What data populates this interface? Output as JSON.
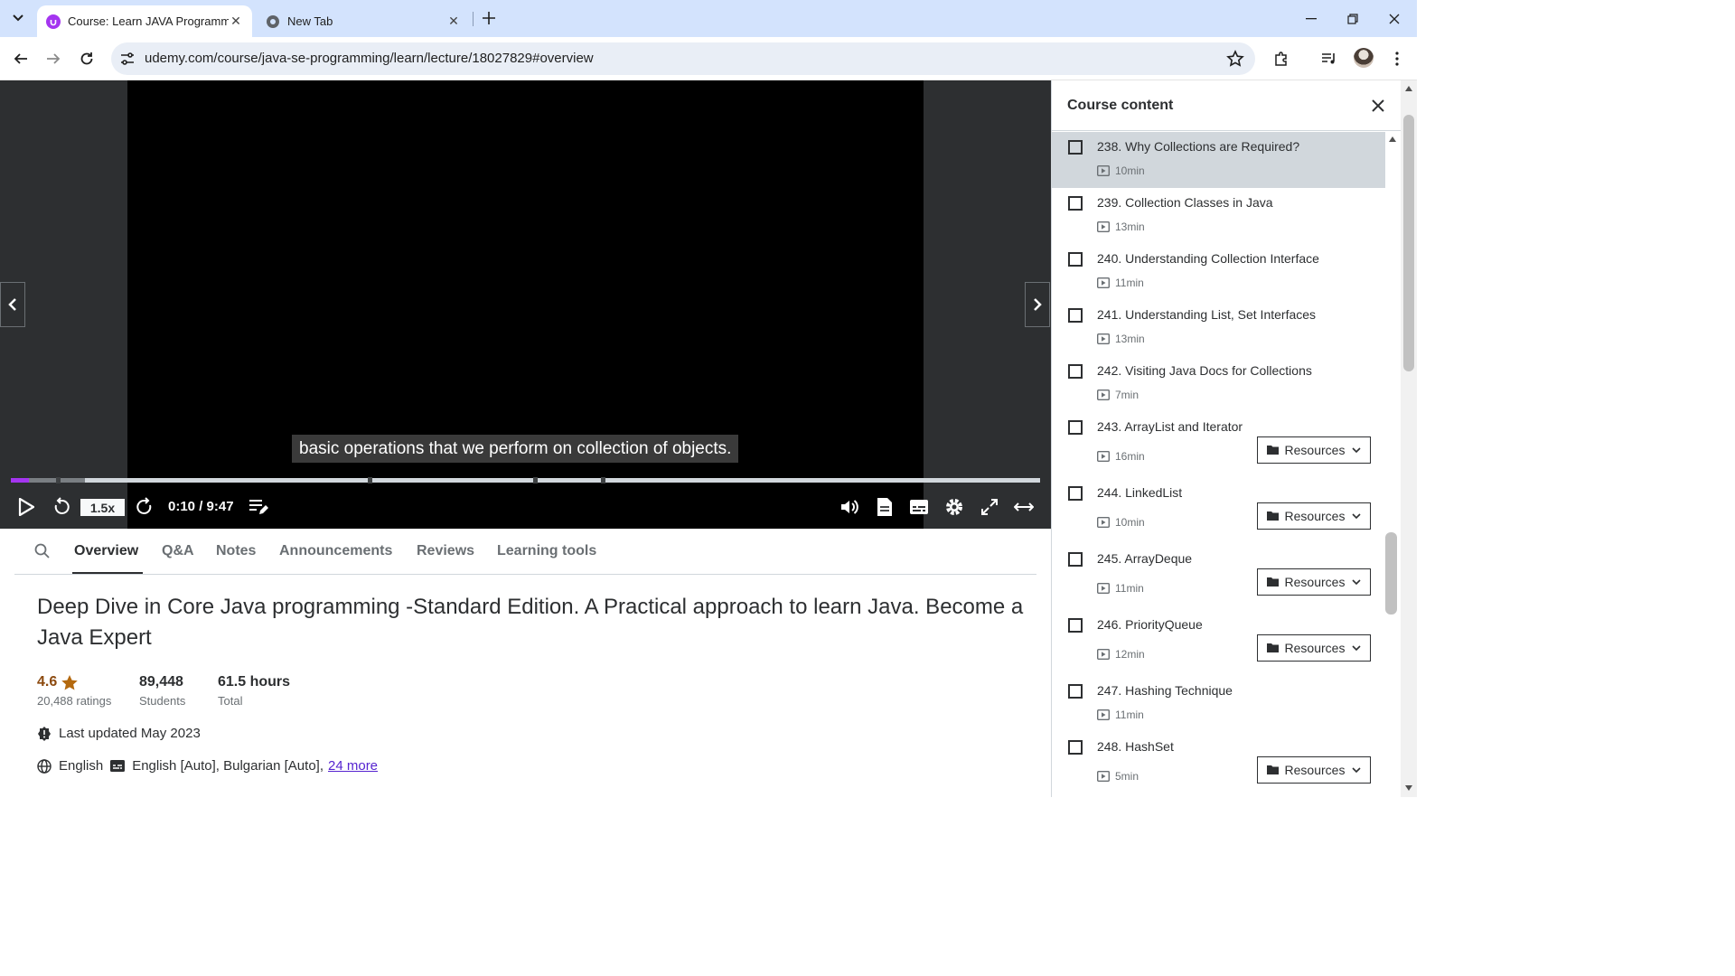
{
  "browser": {
    "tabs": [
      {
        "title": "Course: Learn JAVA Programmin",
        "active": true
      },
      {
        "title": "New Tab",
        "active": false
      }
    ],
    "url": "udemy.com/course/java-se-programming/learn/lecture/18027829#overview"
  },
  "player": {
    "caption": "basic operations that we perform on collection of objects.",
    "speed": "1.5x",
    "time": "0:10 / 9:47",
    "progress": 0.0175
  },
  "tabs": {
    "overview": "Overview",
    "qa": "Q&A",
    "notes": "Notes",
    "announcements": "Announcements",
    "reviews": "Reviews",
    "learning_tools": "Learning tools"
  },
  "course": {
    "title": "Deep Dive in Core Java programming -Standard Edition. A Practical approach to learn Java. Become a Java Expert",
    "rating": "4.6",
    "ratings_count": "20,488 ratings",
    "students": "89,448",
    "students_label": "Students",
    "hours": "61.5 hours",
    "hours_label": "Total",
    "last_updated": "Last updated May 2023",
    "language": "English",
    "captions": "English [Auto], Bulgarian [Auto],",
    "more_link": "24 more"
  },
  "sidebar": {
    "title": "Course content",
    "resources_label": "Resources",
    "lectures": [
      {
        "name": "238. Why Collections are Required?",
        "duration": "10min",
        "resources": false,
        "selected": true
      },
      {
        "name": "239. Collection Classes in Java",
        "duration": "13min",
        "resources": false,
        "selected": false
      },
      {
        "name": "240. Understanding Collection Interface",
        "duration": "11min",
        "resources": false,
        "selected": false
      },
      {
        "name": "241. Understanding List, Set Interfaces",
        "duration": "13min",
        "resources": false,
        "selected": false
      },
      {
        "name": "242. Visiting Java Docs for Collections",
        "duration": "7min",
        "resources": false,
        "selected": false
      },
      {
        "name": "243. ArrayList and Iterator",
        "duration": "16min",
        "resources": true,
        "selected": false
      },
      {
        "name": "244. LinkedList",
        "duration": "10min",
        "resources": true,
        "selected": false
      },
      {
        "name": "245. ArrayDeque",
        "duration": "11min",
        "resources": true,
        "selected": false
      },
      {
        "name": "246. PriorityQueue",
        "duration": "12min",
        "resources": true,
        "selected": false
      },
      {
        "name": "247. Hashing Technique",
        "duration": "11min",
        "resources": false,
        "selected": false
      },
      {
        "name": "248. HashSet",
        "duration": "5min",
        "resources": true,
        "selected": false
      }
    ]
  },
  "colors": {
    "accent": "#a435f0",
    "link": "#5624d0",
    "rating": "#b4690e"
  }
}
